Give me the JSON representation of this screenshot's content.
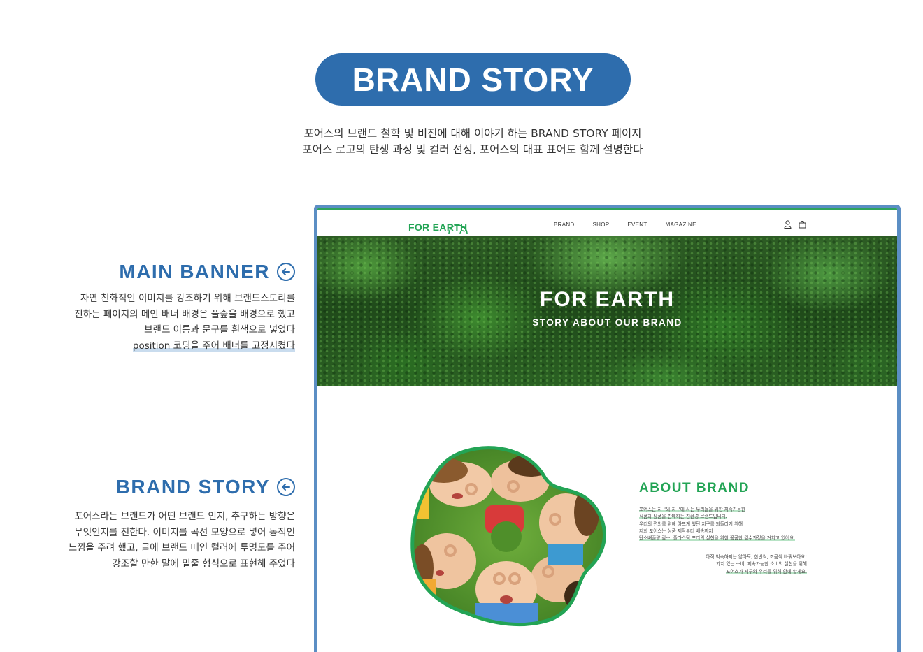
{
  "header": {
    "title": "BRAND STORY",
    "intro_lines": [
      "포어스의 브랜드 철학 및 비전에 대해 이야기 하는 BRAND STORY 페이지",
      "포어스 로고의 탄생 과정 및 컬러 선정, 포어스의 대표 표어도 함께 설명한다"
    ]
  },
  "annotations": [
    {
      "title": "MAIN BANNER",
      "lines": [
        "자연 친화적인 이미지를 강조하기 위해 브랜드스토리를",
        "전하는 페이지의 메인 배너 배경은 풀숲을 배경으로 했고",
        "브랜드 이름과 문구를 흰색으로 넣었다",
        "position 코딩을 주어 배너를 고정시켰다"
      ]
    },
    {
      "title": "BRAND STORY",
      "lines": [
        "포어스라는 브랜드가 어떤 브랜드 인지, 추구하는 방향은",
        "무엇인지를 전한다. 이미지를 곡선 모양으로 넣어 동적인",
        "느낌을 주려 했고, 글에 브랜드 메인 컬러에 투명도를 주어",
        "강조할 만한 말에 밑줄 형식으로 표현해 주었다"
      ]
    }
  ],
  "mockup": {
    "logo": "FOR EARTH",
    "menu": [
      "BRAND",
      "SHOP",
      "EVENT",
      "MAGAZINE"
    ],
    "icons": [
      "user-icon",
      "cart-icon"
    ],
    "banner": {
      "title": "FOR EARTH",
      "subtitle": "STORY ABOUT OUR BRAND"
    },
    "about": {
      "title": "ABOUT BRAND",
      "para1": [
        "포어스는 지구와 지구에 사는 우리들을 위한 지속가능한",
        "식품과 상품을 판매하는 친환경 브랜드입니다.",
        "우리의 편의를 위해 아프게 했던 지구를 되돌리기 위해",
        "저희 포어스는 상품 제작부터 배송까지",
        "탄소배출량 감소, 플라스틱 프리의 실천을 위한 꼼꼼한 검수과정을 거치고 있어요."
      ],
      "para2": [
        "아직 익숙하지는 않아도, 한번씩, 조금씩 바꿔보아요!",
        "가치 있는 소비, 지속가능한 소비의 실천을 위해",
        "포어스가 지구와 우리를 위해 함께 할게요."
      ]
    }
  },
  "colors": {
    "primary_blue": "#2e6dad",
    "frame_blue": "#5b8ec4",
    "brand_green": "#23a455"
  }
}
